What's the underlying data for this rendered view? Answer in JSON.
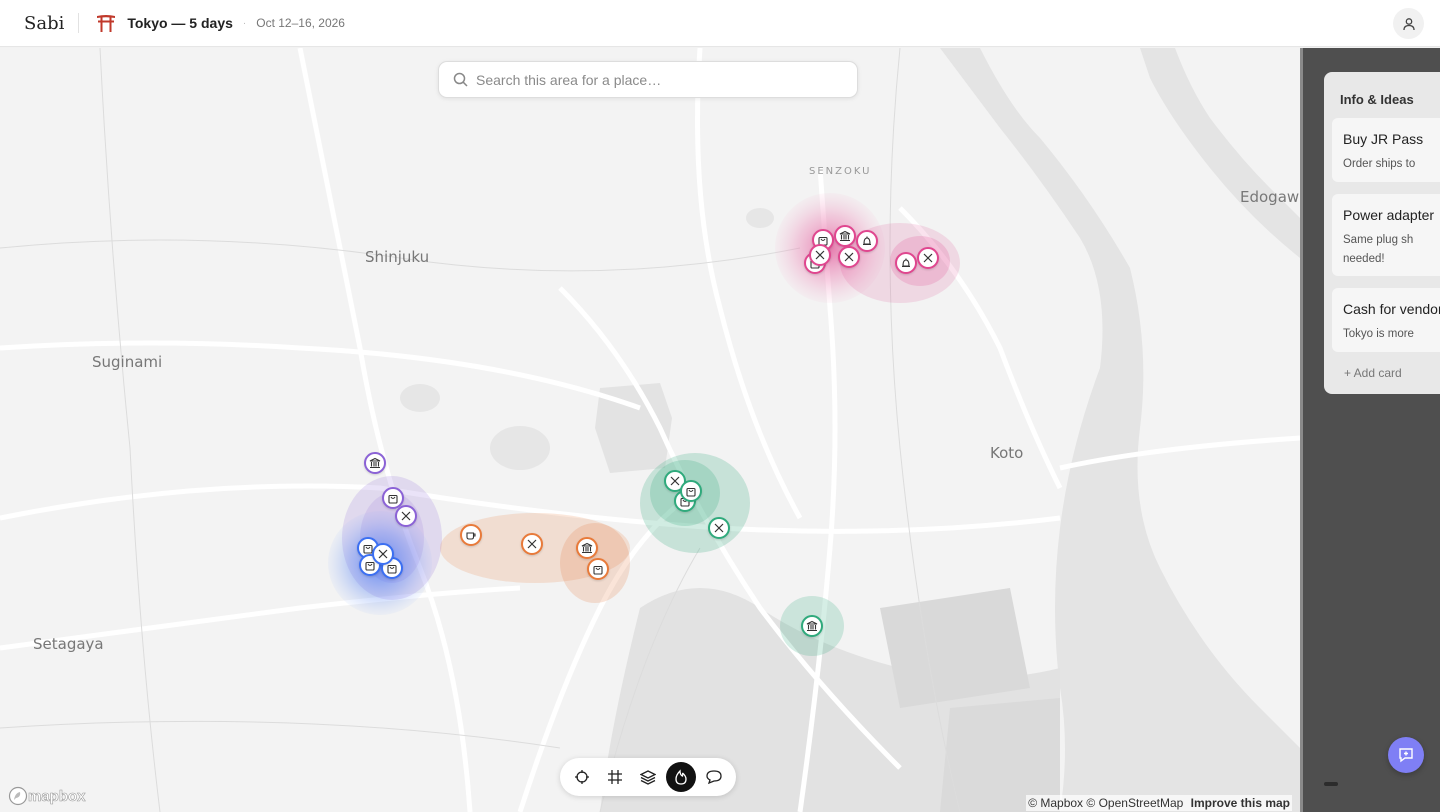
{
  "app": {
    "logo": "Sabi"
  },
  "trip": {
    "title": "Tokyo — 5 days",
    "dates": "Oct 12–16, 2026"
  },
  "search": {
    "placeholder": "Search this area for a place…"
  },
  "map": {
    "labels": [
      "Shinjuku",
      "Suginami",
      "Setagaya",
      "Koto",
      "SENZOKU",
      "Edogaw"
    ],
    "attribution": {
      "mapbox": "© Mapbox",
      "osm": "© OpenStreetMap",
      "improve": "Improve this map"
    },
    "logo": "mapbox"
  },
  "day_colors": {
    "purple": "#8b62d6",
    "blue": "#3b6ff2",
    "orange": "#e87a3a",
    "green": "#2faa7c",
    "pink": "#e0468f"
  },
  "toolbar": {
    "tools": [
      {
        "icon": "crosshair-icon",
        "active": false
      },
      {
        "icon": "grid-icon",
        "active": false
      },
      {
        "icon": "layers-icon",
        "active": false
      },
      {
        "icon": "flame-icon",
        "active": true
      },
      {
        "icon": "comment-icon",
        "active": false
      }
    ]
  },
  "panel": {
    "list_title": "Info & Ideas",
    "cards": [
      {
        "title": "Buy JR Pass",
        "desc": "Order ships to"
      },
      {
        "title": "Power adapter",
        "desc": "Same plug sh needed!"
      },
      {
        "title": "Cash for vendors",
        "desc": "Tokyo is more"
      }
    ],
    "add_card": "+ Add card"
  }
}
